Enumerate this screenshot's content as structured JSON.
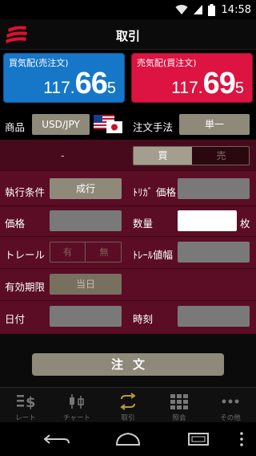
{
  "status": {
    "time": "14:58",
    "icons": [
      "wifi-icon",
      "signal-icon",
      "battery-icon"
    ]
  },
  "header": {
    "title": "取引",
    "logo_icon": "brand-logo-icon"
  },
  "prices": {
    "bid": {
      "label": "買気配(売注文)",
      "prefix": "117.",
      "big": "66",
      "pip": "5"
    },
    "ask": {
      "label": "売気配(買注文)",
      "prefix": "117.",
      "big": "69",
      "pip": "5"
    }
  },
  "form": {
    "symbol_label": "商品",
    "symbol_value": "USD/JPY",
    "flag_icons": [
      "us-flag-icon",
      "jp-flag-icon"
    ],
    "method_label": "注文手法",
    "method_value": "単一",
    "dash_text": "-",
    "side_buy": "買",
    "side_sell": "売",
    "exec_label": "執行条件",
    "exec_value": "成行",
    "trigger_label": "ﾄﾘｶﾞ 価格",
    "trigger_value": "",
    "price_label": "価格",
    "price_value": "",
    "qty_label": "数量",
    "qty_value": "",
    "qty_unit": "枚",
    "trail_label": "トレール",
    "trail_yes": "有",
    "trail_no": "無",
    "trail_width_label": "ﾄﾚｰﾙ値幅",
    "trail_width_value": "",
    "expiry_label": "有効期限",
    "expiry_value": "当日",
    "date_label": "日付",
    "date_value": "",
    "time_label": "時刻",
    "time_value": ""
  },
  "order_button": "注文",
  "tabs": [
    {
      "label": "レート",
      "icon": "yen-rate-icon"
    },
    {
      "label": "チャート",
      "icon": "candlestick-chart-icon"
    },
    {
      "label": "取引",
      "icon": "exchange-arrows-icon"
    },
    {
      "label": "照会",
      "icon": "grid-icon"
    },
    {
      "label": "その他",
      "icon": "more-dots-icon"
    }
  ],
  "colors": {
    "bid": "#1677c9",
    "ask": "#dd1341",
    "panel": "#5a0d25",
    "pill": "#8f8979"
  }
}
